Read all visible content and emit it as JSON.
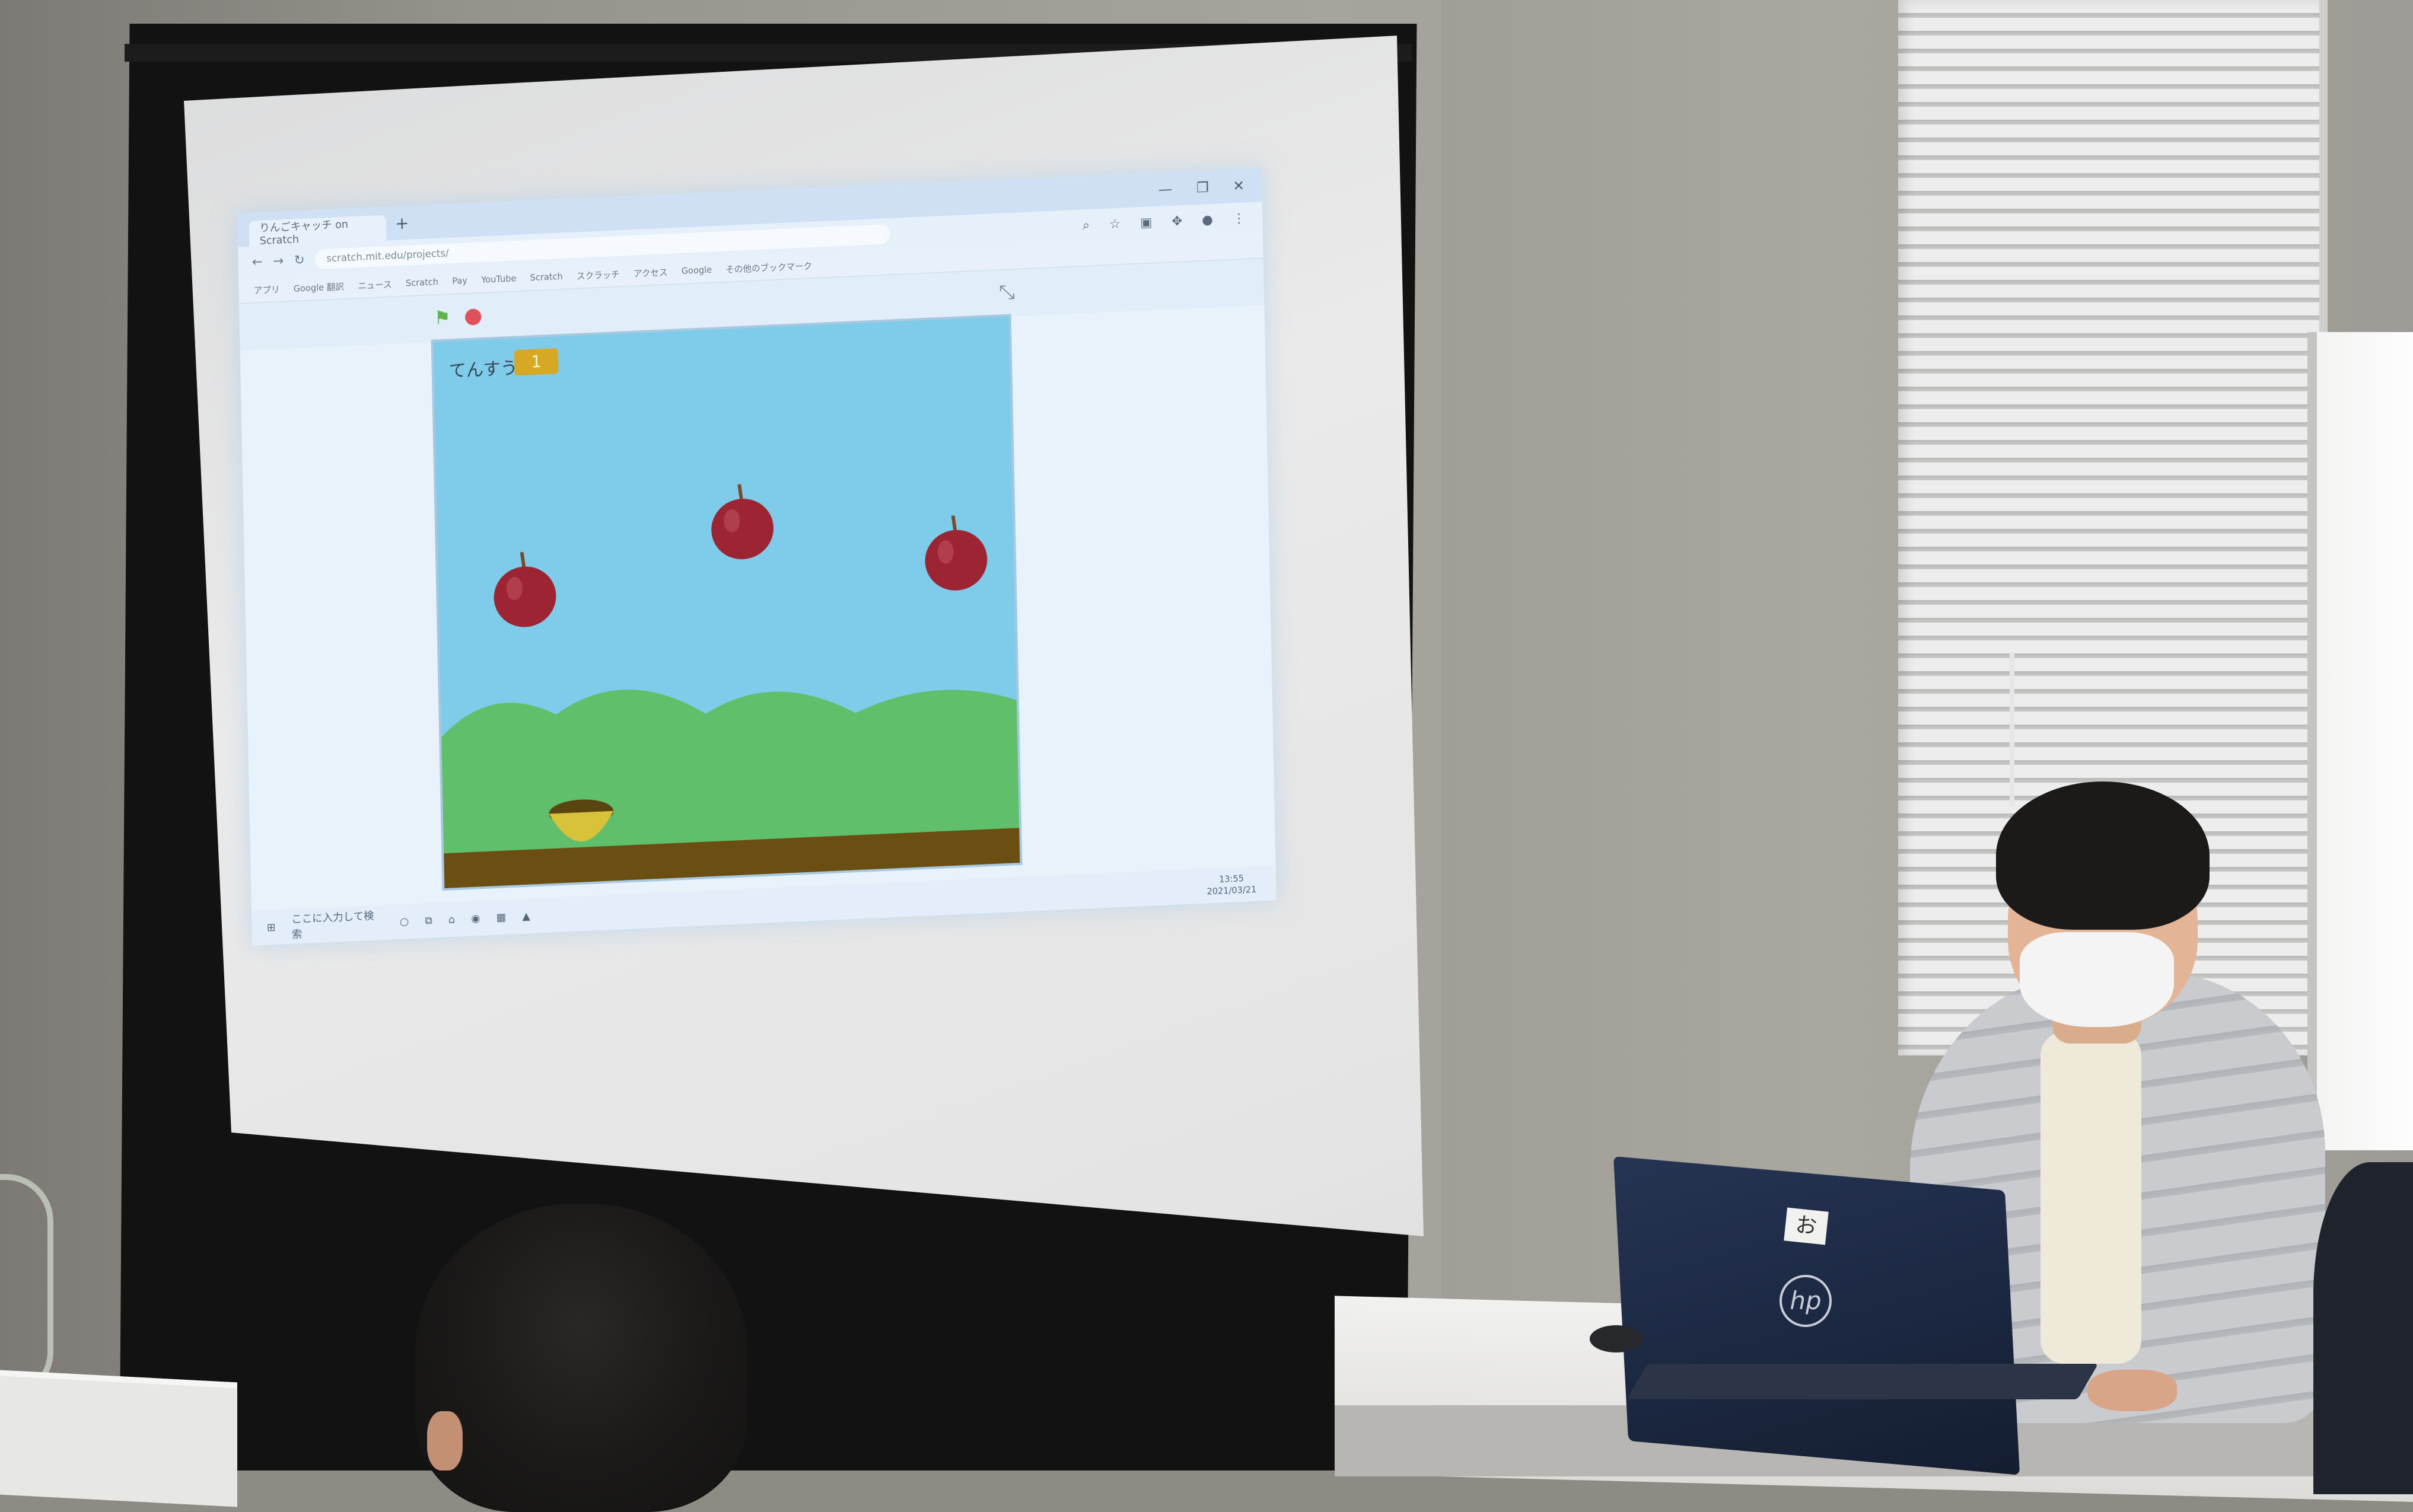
{
  "scene": {
    "description_tags": [
      "classroom",
      "projector-screen",
      "student-presenting",
      "laptop"
    ]
  },
  "browser": {
    "tab_title": "りんごキャッチ on Scratch",
    "url": "scratch.mit.edu/projects/",
    "window_controls": [
      "—",
      "❐",
      "✕"
    ],
    "bookmarks": [
      "アプリ",
      "Google 翻訳",
      "ニュース",
      "Scratch",
      "Pay",
      "YouTube",
      "Scratch",
      "スクラッチ",
      "アクセス",
      "Google",
      "その他のブックマーク"
    ]
  },
  "player": {
    "score_label": "てんすう",
    "score_value": "1"
  },
  "taskbar": {
    "search_placeholder": "ここに入力して検索",
    "time": "13:55",
    "date": "2021/03/21"
  },
  "laptop": {
    "sticker_text": "お",
    "brand_logo": "hp"
  },
  "colors": {
    "stage_sky": "#7fcbea",
    "hills": "#5fbf6a",
    "ground": "#6a4e12",
    "apple": "#9c2433",
    "basket": "#d8c23a",
    "score_badge": "#d6a824"
  }
}
